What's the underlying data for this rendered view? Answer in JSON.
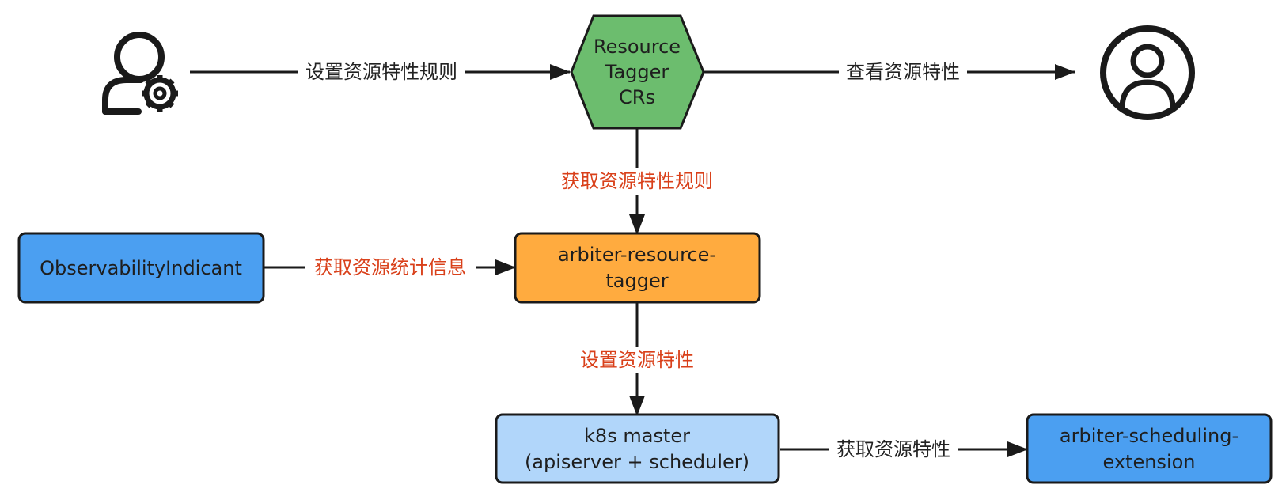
{
  "nodes": {
    "tagger_crs": {
      "lines": [
        "Resource",
        "Tagger",
        "CRs"
      ],
      "fill": "#6cbd6e"
    },
    "resource_tagger": {
      "lines": [
        "arbiter-resource-",
        "tagger"
      ],
      "fill": "#ffab3f"
    },
    "observability": {
      "lines": [
        "ObservabilityIndicant"
      ],
      "fill": "#4b9ff1"
    },
    "k8s_master": {
      "lines": [
        "k8s master",
        "(apiserver + scheduler)"
      ],
      "fill": "#b1d6fa"
    },
    "scheduling_extension": {
      "lines": [
        "arbiter-scheduling-",
        "extension"
      ],
      "fill": "#4b9ff1"
    }
  },
  "actors": {
    "admin": {
      "icon": "user-gear-icon"
    },
    "viewer": {
      "icon": "user-circle-icon"
    }
  },
  "edges": {
    "admin_to_crs": {
      "label": "设置资源特性规则",
      "color": "#222222"
    },
    "crs_to_viewer": {
      "label": "查看资源特性",
      "color": "#222222"
    },
    "crs_to_tagger": {
      "label": "获取资源特性规则",
      "color": "#d9401a"
    },
    "observ_to_tagger": {
      "label": "获取资源统计信息",
      "color": "#d9401a"
    },
    "tagger_to_k8s": {
      "label": "设置资源特性",
      "color": "#d9401a"
    },
    "k8s_to_extension": {
      "label": "获取资源特性",
      "color": "#222222"
    }
  }
}
